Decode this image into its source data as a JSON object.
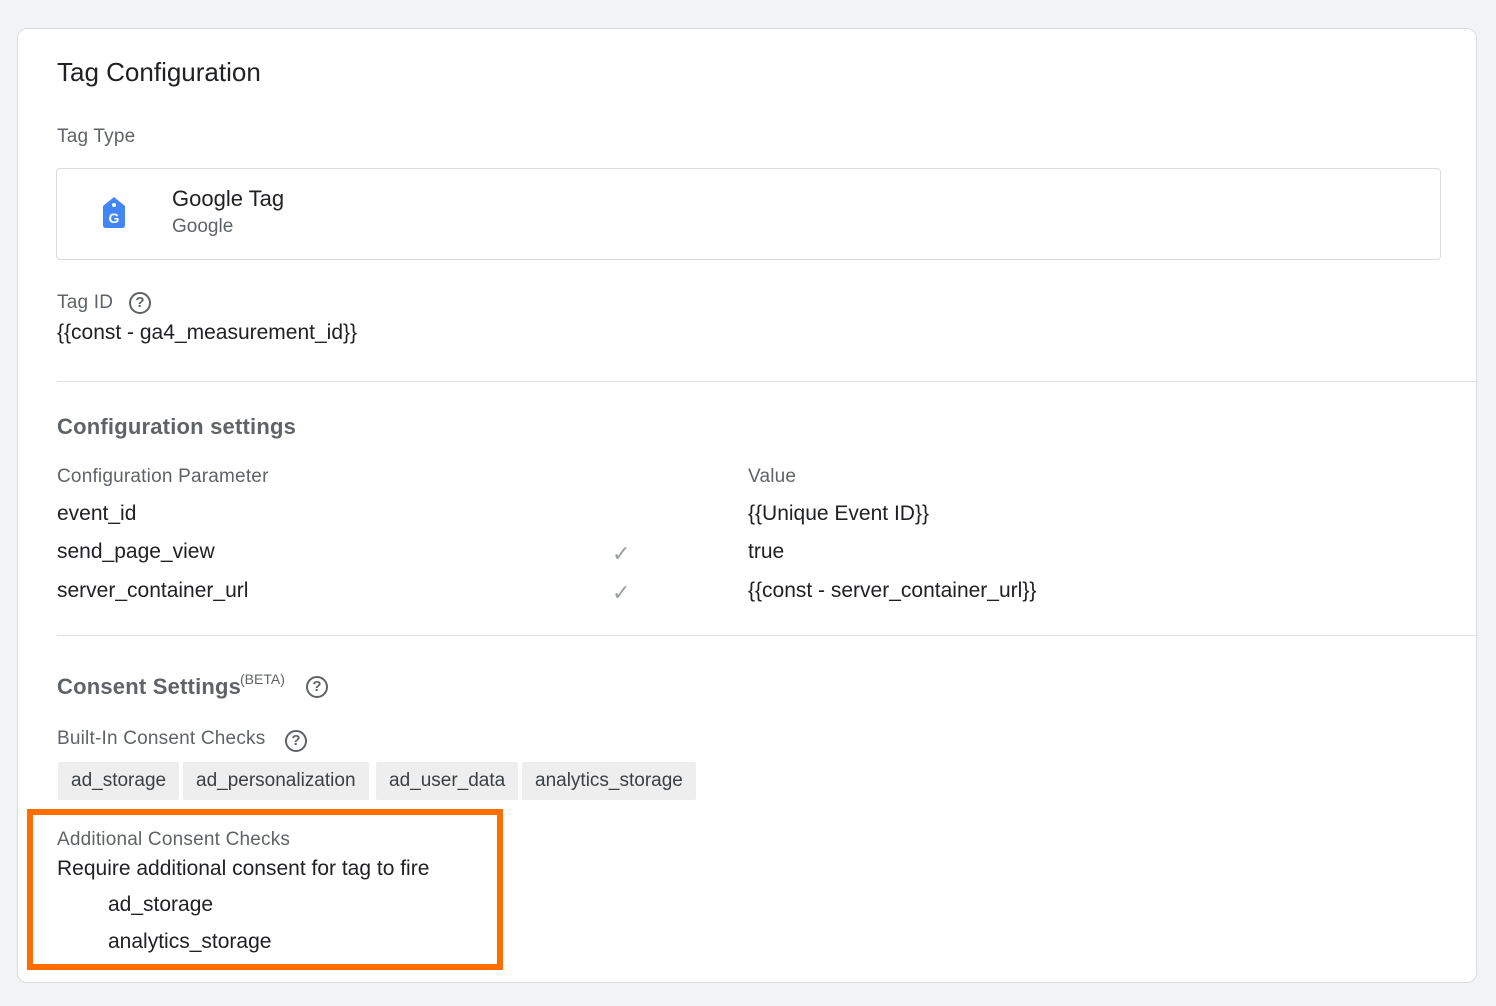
{
  "card": {
    "title": "Tag Configuration",
    "tag_type_label": "Tag Type",
    "tag_type": {
      "name": "Google Tag",
      "vendor": "Google",
      "icon": "google-tag-icon"
    },
    "tag_id_label": "Tag ID",
    "tag_id_value": "{{const - ga4_measurement_id}}",
    "config": {
      "title": "Configuration settings",
      "param_header": "Configuration Parameter",
      "value_header": "Value",
      "rows": [
        {
          "param": "event_id",
          "checked": false,
          "value": "{{Unique Event ID}}"
        },
        {
          "param": "send_page_view",
          "checked": true,
          "value": "true"
        },
        {
          "param": "server_container_url",
          "checked": true,
          "value": "{{const - server_container_url}}"
        }
      ]
    },
    "consent": {
      "title": "Consent Settings",
      "beta": "(BETA)",
      "builtin_label": "Built-In Consent Checks",
      "builtin_chips": [
        "ad_storage",
        "ad_personalization",
        "ad_user_data",
        "analytics_storage"
      ],
      "additional_label": "Additional Consent Checks",
      "additional_text": "Require additional consent for tag to fire",
      "additional_items": [
        "ad_storage",
        "analytics_storage"
      ]
    },
    "colors": {
      "highlight": "#ff6d00",
      "google_blue": "#4285f4"
    }
  }
}
